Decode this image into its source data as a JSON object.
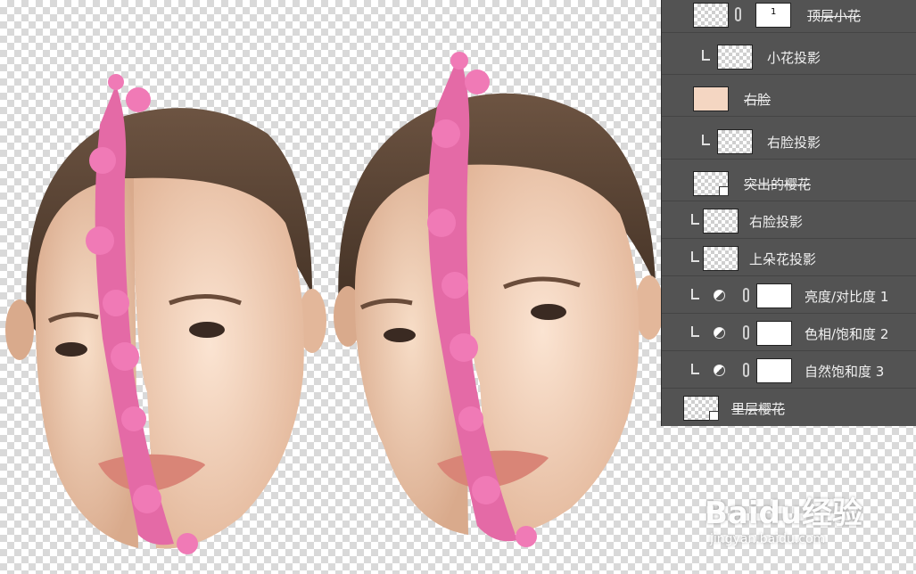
{
  "canvas": {
    "description_icon": "photoshop-transparent-canvas",
    "faces": [
      "left-face-composite",
      "right-face-composite"
    ]
  },
  "layers_panel": {
    "rows": [
      {
        "name": "顶层小花",
        "has_mask": true,
        "mask_mark": "1",
        "clipped": false,
        "adjustment": false,
        "struck": true
      },
      {
        "name": "小花投影",
        "has_mask": false,
        "clipped": true,
        "adjustment": false,
        "struck": false
      },
      {
        "name": "右脸",
        "has_mask": false,
        "clipped": false,
        "adjustment": false,
        "struck": true
      },
      {
        "name": "右脸投影",
        "has_mask": false,
        "clipped": true,
        "adjustment": false,
        "struck": false
      },
      {
        "name": "突出的樱花",
        "has_mask": false,
        "clipped": false,
        "adjustment": false,
        "struck": true
      },
      {
        "name": "右脸投影",
        "has_mask": false,
        "clipped": true,
        "adjustment": false,
        "struck": false
      },
      {
        "name": "上朵花投影",
        "has_mask": false,
        "clipped": true,
        "adjustment": false,
        "struck": false
      },
      {
        "name": "亮度/对比度 1",
        "has_mask": true,
        "clipped": true,
        "adjustment": true,
        "struck": false
      },
      {
        "name": "色相/饱和度 2",
        "has_mask": true,
        "clipped": true,
        "adjustment": true,
        "struck": false
      },
      {
        "name": "自然饱和度 3",
        "has_mask": true,
        "clipped": true,
        "adjustment": true,
        "struck": false
      },
      {
        "name": "里层樱花",
        "has_mask": false,
        "clipped": false,
        "adjustment": false,
        "struck": true
      }
    ]
  },
  "watermark": {
    "main": "Baidu经验",
    "sub": "jingyan.baidu.com"
  },
  "colors": {
    "panel_bg": "#535353",
    "blossom": "#e0589a",
    "hair": "#5a4636",
    "skin": "#f1cfb6"
  }
}
